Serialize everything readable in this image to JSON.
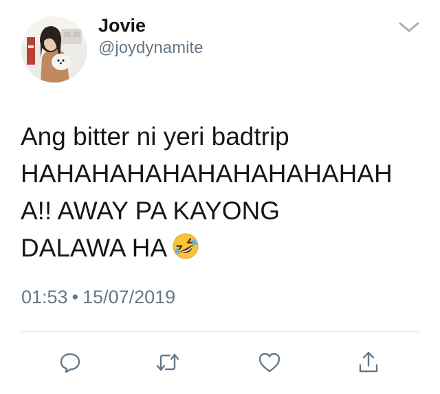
{
  "user": {
    "display_name": "Jovie",
    "handle": "@joydynamite",
    "avatar_icon": "profile-photo"
  },
  "tweet": {
    "text_lines": [
      "Ang bitter ni yeri badtrip",
      "HAHAHAHAHAHAHAHAHAHAH",
      "A!! AWAY PA KAYONG",
      "DALAWA HA"
    ],
    "emoji_icon": "rolling-on-floor-laughing-emoji",
    "time": "01:53",
    "separator": "•",
    "date": "15/07/2019"
  },
  "actions": {
    "reply_icon": "reply-icon",
    "retweet_icon": "retweet-icon",
    "like_icon": "like-icon",
    "share_icon": "share-icon"
  },
  "colors": {
    "text": "#14171a",
    "secondary": "#657786",
    "icon": "#657786",
    "divider": "#d6dbdf",
    "emoji_face": "#f8c53a"
  }
}
